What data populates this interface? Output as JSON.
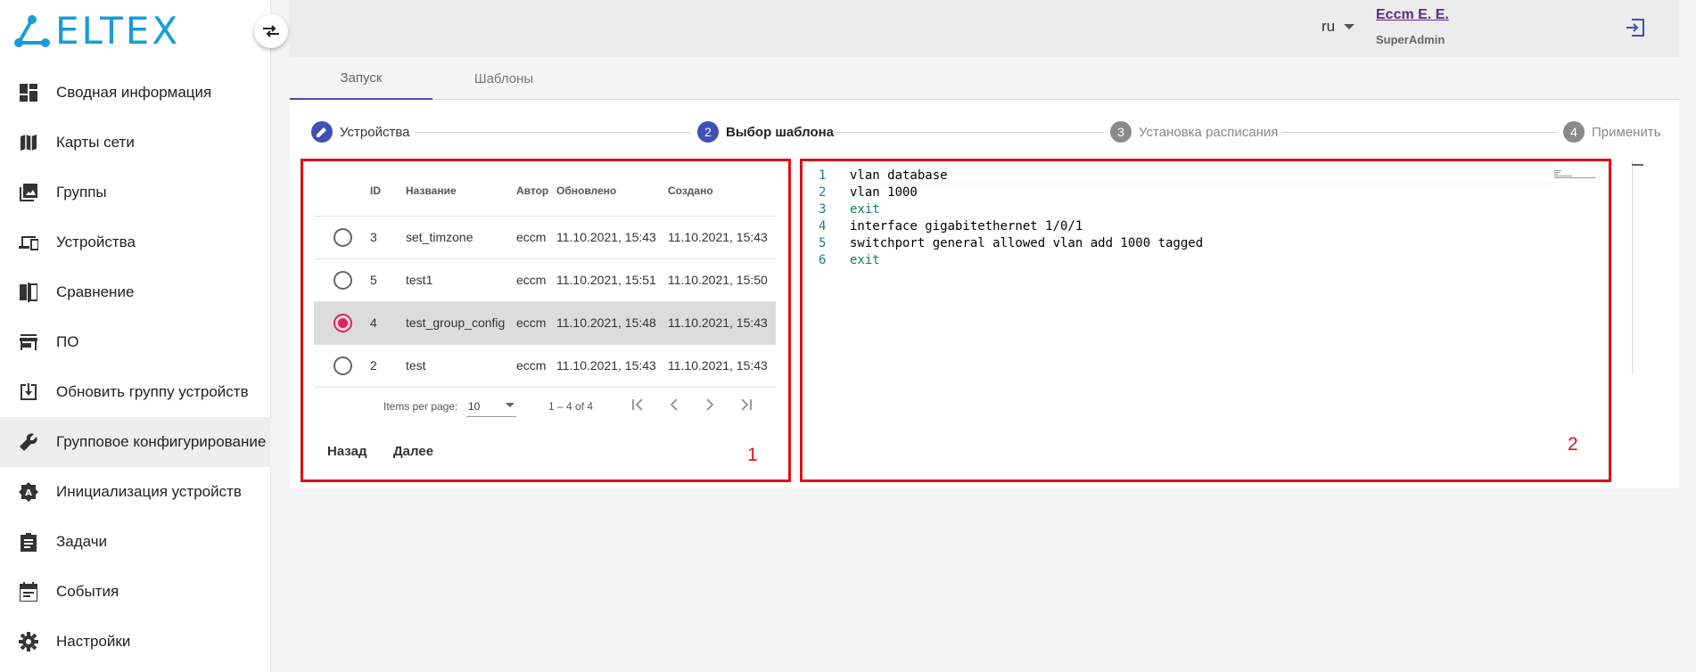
{
  "logo": {
    "text": "ELTEX"
  },
  "sidebar": {
    "items": [
      {
        "label": "Сводная информация",
        "icon": "dashboard-icon"
      },
      {
        "label": "Карты сети",
        "icon": "map-icon"
      },
      {
        "label": "Группы",
        "icon": "photo-library-icon"
      },
      {
        "label": "Устройства",
        "icon": "devices-icon"
      },
      {
        "label": "Сравнение",
        "icon": "compare-icon"
      },
      {
        "label": "ПО",
        "icon": "store-icon"
      },
      {
        "label": "Обновить группу устройств",
        "icon": "download-icon"
      },
      {
        "label": "Групповое конфигурирование",
        "icon": "wrench-icon"
      },
      {
        "label": "Инициализация устройств",
        "icon": "auto-init-icon"
      },
      {
        "label": "Задачи",
        "icon": "clipboard-icon"
      },
      {
        "label": "События",
        "icon": "calendar-icon"
      },
      {
        "label": "Настройки",
        "icon": "gear-icon"
      }
    ],
    "active_index": 7
  },
  "header": {
    "lang": "ru",
    "user_name": "Eccm E. E.",
    "user_role": "SuperAdmin"
  },
  "tabs": [
    {
      "label": "Запуск"
    },
    {
      "label": "Шаблоны"
    }
  ],
  "stepper": {
    "steps": [
      {
        "num": "",
        "label": "Устройства",
        "state": "done"
      },
      {
        "num": "2",
        "label": "Выбор шаблона",
        "state": "active"
      },
      {
        "num": "3",
        "label": "Установка расписания",
        "state": "pending"
      },
      {
        "num": "4",
        "label": "Применить",
        "state": "pending"
      }
    ]
  },
  "table": {
    "columns": [
      "ID",
      "Название",
      "Автор",
      "Обновлено",
      "Создано"
    ],
    "rows": [
      {
        "id": "3",
        "name": "set_timzone",
        "author": "eccm",
        "updated": "11.10.2021, 15:43",
        "created": "11.10.2021, 15:43",
        "selected": false
      },
      {
        "id": "5",
        "name": "test1",
        "author": "eccm",
        "updated": "11.10.2021, 15:51",
        "created": "11.10.2021, 15:50",
        "selected": false
      },
      {
        "id": "4",
        "name": "test_group_config",
        "author": "eccm",
        "updated": "11.10.2021, 15:48",
        "created": "11.10.2021, 15:43",
        "selected": true
      },
      {
        "id": "2",
        "name": "test",
        "author": "eccm",
        "updated": "11.10.2021, 15:43",
        "created": "11.10.2021, 15:43",
        "selected": false
      }
    ],
    "pager": {
      "items_per_page_label": "Items per page:",
      "items_per_page": "10",
      "range": "1 – 4 of 4"
    },
    "back_label": "Назад",
    "next_label": "Далее",
    "panel_number": "1"
  },
  "editor": {
    "lines": [
      {
        "num": "1",
        "text": "vlan database",
        "keyword": false
      },
      {
        "num": "2",
        "text": "vlan 1000",
        "keyword": false
      },
      {
        "num": "3",
        "text": "exit",
        "keyword": true
      },
      {
        "num": "4",
        "text": "interface gigabitethernet 1/0/1",
        "keyword": false
      },
      {
        "num": "5",
        "text": "switchport general allowed vlan add 1000 tagged",
        "keyword": false
      },
      {
        "num": "6",
        "text": "exit",
        "keyword": true
      }
    ],
    "panel_number": "2"
  },
  "colors": {
    "accent": "#3f51b5",
    "selected_radio": "#e91e63",
    "highlight_border": "#e0101a",
    "logo_blue": "#1a9bd7"
  }
}
